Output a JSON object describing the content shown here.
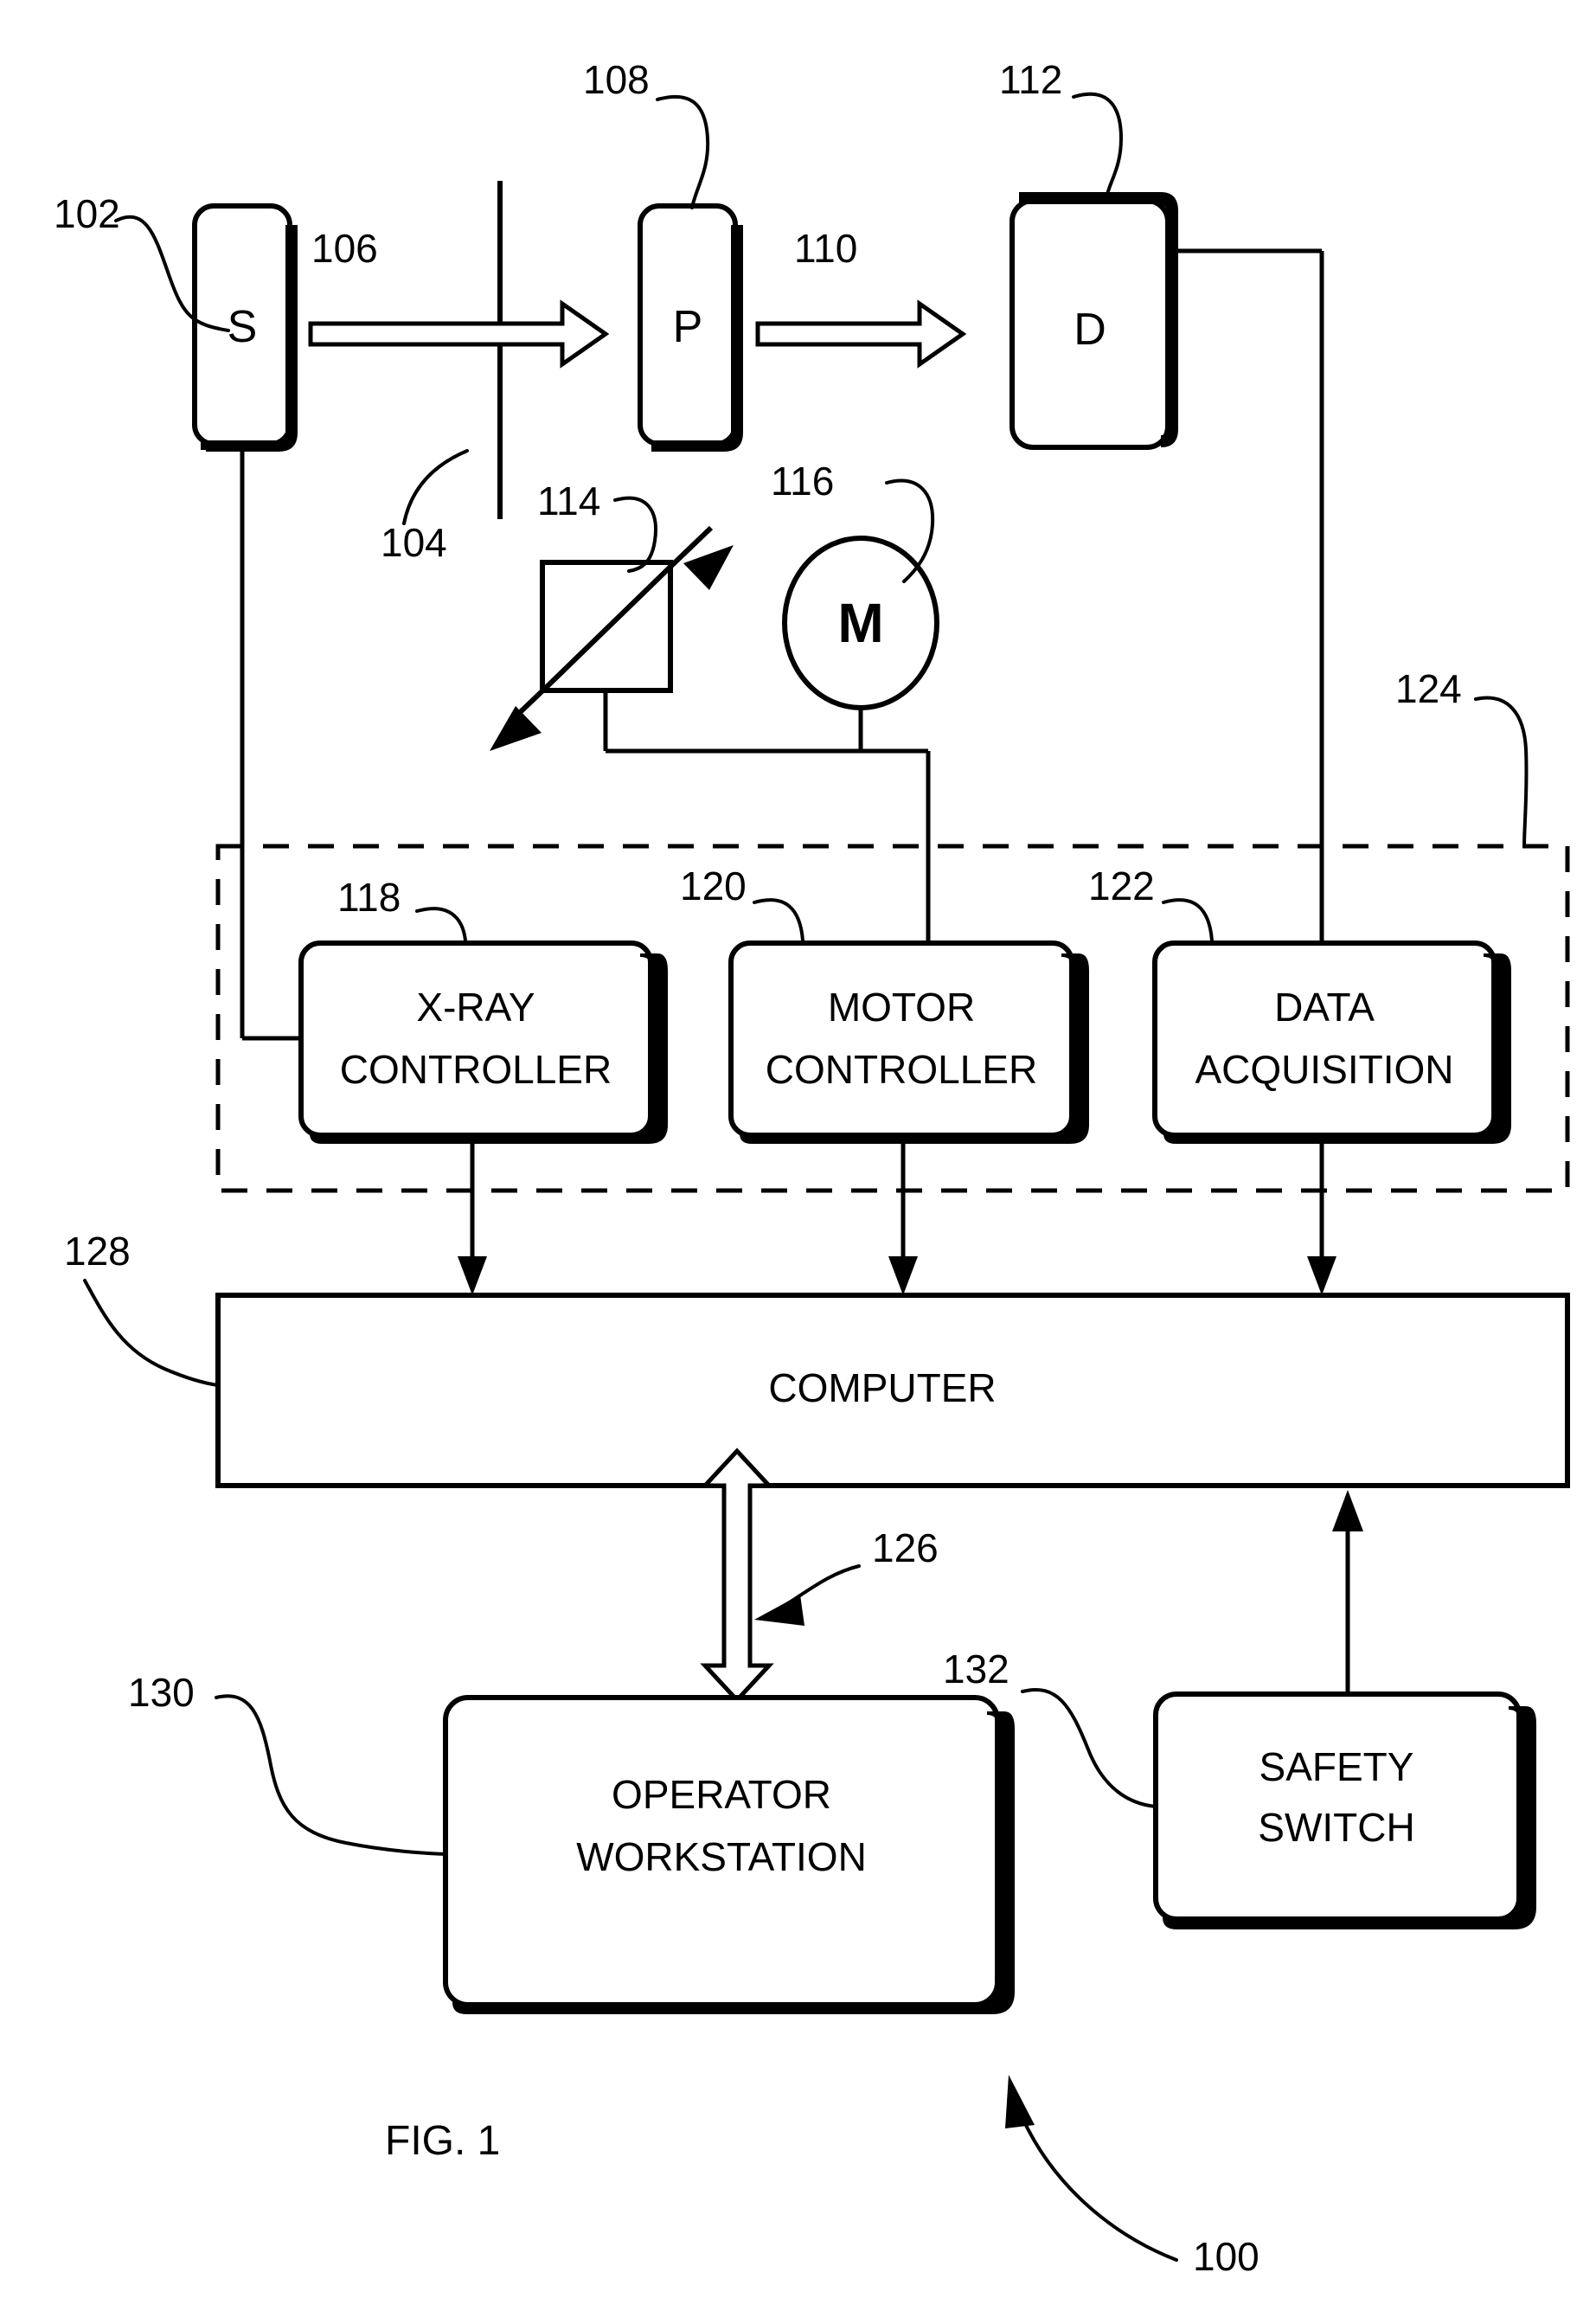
{
  "figure": {
    "caption": "FIG. 1",
    "system_ref": "100"
  },
  "reference_numerals": {
    "system": "100",
    "source": "102",
    "aperture": "104",
    "incident_beam": "106",
    "phantom": "108",
    "transmitted_beam": "110",
    "detector": "112",
    "stage": "114",
    "motor": "116",
    "xray_controller": "118",
    "motor_controller": "120",
    "data_acquisition": "122",
    "control_subsystem": "124",
    "bidirectional_link": "126",
    "computer": "128",
    "operator_workstation": "130",
    "safety_switch": "132"
  },
  "blocks": {
    "source": {
      "label": "S",
      "ref": "102"
    },
    "phantom": {
      "label": "P",
      "ref": "108"
    },
    "detector": {
      "label": "D",
      "ref": "112"
    },
    "motor": {
      "label": "M",
      "ref": "116"
    },
    "stage": {
      "label": "",
      "ref": "114"
    },
    "xray_controller": {
      "line1": "X-RAY",
      "line2": "CONTROLLER",
      "ref": "118"
    },
    "motor_controller": {
      "line1": "MOTOR",
      "line2": "CONTROLLER",
      "ref": "120"
    },
    "data_acquisition": {
      "line1": "DATA",
      "line2": "ACQUISITION",
      "ref": "122"
    },
    "computer": {
      "label": "COMPUTER",
      "ref": "128"
    },
    "operator_workstation": {
      "line1": "OPERATOR",
      "line2": "WORKSTATION",
      "ref": "130"
    },
    "safety_switch": {
      "line1": "SAFETY",
      "line2": "SWITCH",
      "ref": "132"
    }
  },
  "colors": {
    "ink": "#000000",
    "paper": "#ffffff"
  }
}
